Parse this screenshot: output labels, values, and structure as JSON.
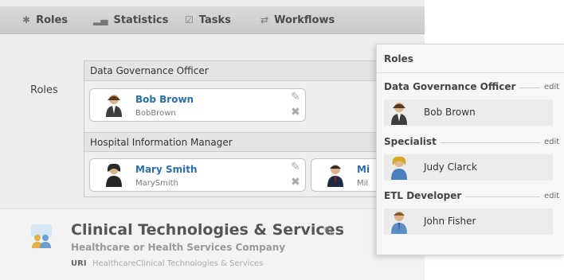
{
  "tabs": [
    {
      "label": "Roles",
      "icon": "person-icon"
    },
    {
      "label": "Statistics",
      "icon": "bar-chart-icon"
    },
    {
      "label": "Tasks",
      "icon": "checkbox-icon"
    },
    {
      "label": "Workflows",
      "icon": "arrows-icon"
    }
  ],
  "roles_section": {
    "label": "Roles",
    "groups": [
      {
        "title": "Data Governance Officer",
        "members": [
          {
            "name": "Bob Brown",
            "username": "BobBrown"
          }
        ]
      },
      {
        "title": "Hospital Information Manager",
        "members": [
          {
            "name": "Mary Smith",
            "username": "MarySmith"
          },
          {
            "name": "Mi",
            "username": "Mil"
          }
        ]
      }
    ]
  },
  "org": {
    "title": "Clinical Technologies & Services",
    "subtitle": "Healthcare or Health Services Company",
    "uri_label": "URI",
    "uri_value": "HealthcareClinical Technologies & Services"
  },
  "panel": {
    "title": "Roles",
    "groups": [
      {
        "title": "Data Governance Officer",
        "edit": "edit",
        "member": "Bob Brown"
      },
      {
        "title": "Specialist",
        "edit": "edit",
        "member": "Judy Clarck"
      },
      {
        "title": "ETL Developer",
        "edit": "edit",
        "member": "John Fisher"
      }
    ]
  },
  "colors": {
    "link_blue": "#2a6fa8",
    "tab_bar": "#d0d0d0",
    "main_bg": "#eeeeee"
  }
}
